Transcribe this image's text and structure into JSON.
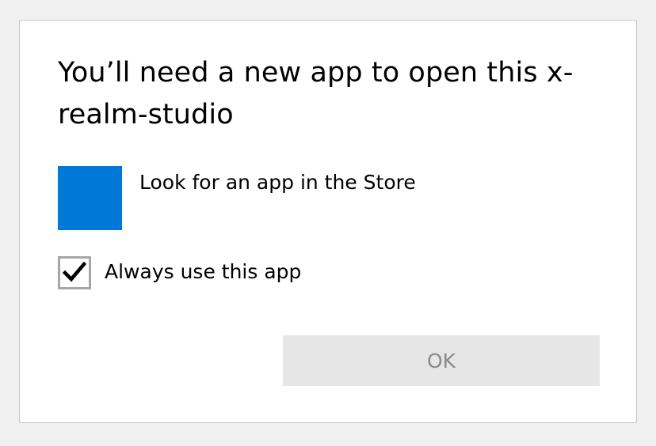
{
  "dialog": {
    "title": "You’ll need a new app to open this x-realm-studio",
    "store_option": {
      "label": "Look for an app in the Store",
      "tile_color": "#0078d7",
      "icon": "store-tile"
    },
    "always_use": {
      "label": "Always use this app",
      "checked": true
    },
    "ok_button": {
      "label": "OK",
      "enabled": false
    }
  }
}
